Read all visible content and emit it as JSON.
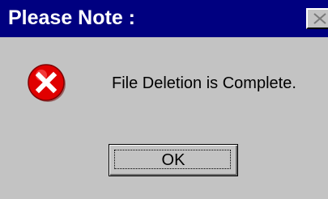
{
  "window": {
    "title": "Please Note :",
    "close_icon": "close-icon"
  },
  "message": {
    "icon": "error-icon",
    "text": "File Deletion is Complete."
  },
  "buttons": {
    "ok_label": "OK"
  },
  "colors": {
    "titlebar": "#000080",
    "title_text": "#ffffff",
    "dialog_face": "#c3c3c3",
    "error_red": "#e00000"
  }
}
